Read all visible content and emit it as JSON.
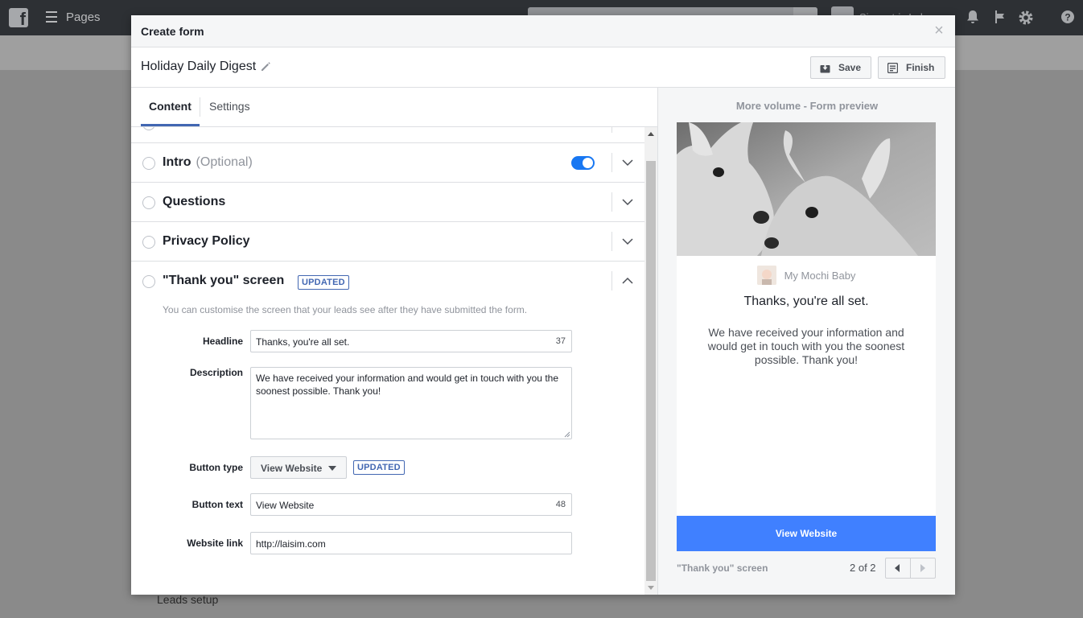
{
  "topbar": {
    "pages_label": "Pages",
    "user_name": "Simmetrix Labs"
  },
  "background": {
    "leads_setup": "Leads setup"
  },
  "modal": {
    "title": "Create form",
    "close_symbol": "×",
    "form_name": "Holiday Daily Digest",
    "save_label": "Save",
    "finish_label": "Finish"
  },
  "tabs": [
    {
      "label": "Content",
      "active": true
    },
    {
      "label": "Settings",
      "active": false
    }
  ],
  "sections": {
    "intro": {
      "title": "Intro",
      "optional": "(Optional)",
      "enabled": true
    },
    "questions": {
      "title": "Questions"
    },
    "privacy": {
      "title": "Privacy Policy"
    },
    "thank_you": {
      "title": "\"Thank you\" screen",
      "badge": "UPDATED",
      "description": "You can customise the screen that your leads see after they have submitted the form.",
      "headline_label": "Headline",
      "headline_value": "Thanks, you're all set.",
      "headline_count": "37",
      "description_label": "Description",
      "description_value": "We have received your information and would get in touch with you the soonest possible. Thank you!",
      "button_type_label": "Button type",
      "button_type_value": "View Website",
      "button_type_badge": "UPDATED",
      "button_text_label": "Button text",
      "button_text_value": "View Website",
      "button_text_count": "48",
      "website_link_label": "Website link",
      "website_link_value": "http://laisim.com"
    }
  },
  "preview": {
    "title": "More volume - Form preview",
    "page_name": "My Mochi Baby",
    "headline": "Thanks, you're all set.",
    "description": "We have received your information and would get in touch with you the soonest possible. Thank you!",
    "button_label": "View Website",
    "footer_label": "\"Thank you\" screen",
    "page_count": "2 of 2"
  },
  "colors": {
    "accent": "#4267b2",
    "toggle_on": "#1877f2",
    "preview_button": "#4080ff"
  }
}
